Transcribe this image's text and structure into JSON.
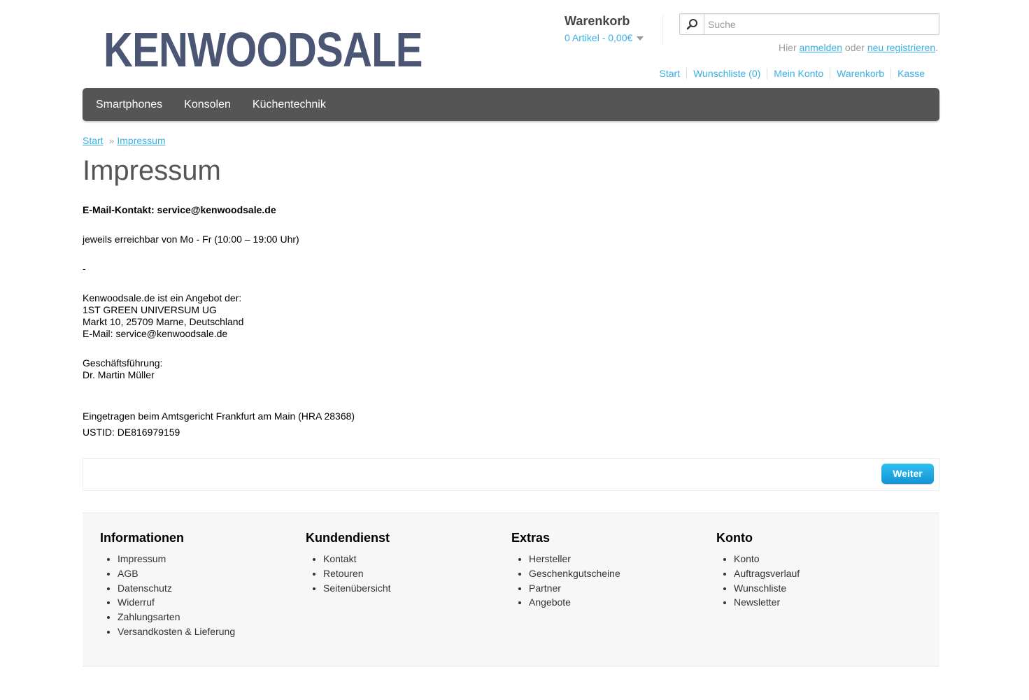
{
  "logo": "KENWOODSALE",
  "cart": {
    "title": "Warenkorb",
    "info": "0 Artikel - 0,00€"
  },
  "search": {
    "placeholder": "Suche"
  },
  "login": {
    "prefix": "Hier",
    "login_link": "anmelden",
    "middle": "oder",
    "register_link": "neu registrieren",
    "suffix": "."
  },
  "toplinks": [
    "Start",
    "Wunschliste (0)",
    "Mein Konto",
    "Warenkorb",
    "Kasse"
  ],
  "menu": [
    "Smartphones",
    "Konsolen",
    "Küchentechnik"
  ],
  "breadcrumb": {
    "home": "Start",
    "sep": "»",
    "current": "Impressum"
  },
  "page_title": "Impressum",
  "content": {
    "email_contact": "E-Mail-Kontakt: service@kenwoodsale.de",
    "hours": "jeweils erreichbar von Mo - Fr (10:00 – 19:00 Uhr)",
    "dash": "-",
    "company_line1": "Kenwoodsale.de ist ein Angebot der:",
    "company_line2": "1ST GREEN UNIVERSUM UG",
    "company_line3": "Markt 10, 25709 Marne, Deutschland",
    "company_line4": "E-Mail: service@kenwoodsale.de",
    "management_label": "Geschäftsführung:",
    "management_name": "Dr. Martin Müller",
    "register": "Eingetragen beim Amtsgericht Frankfurt am Main (HRA 28368)",
    "ustid": "USTID: DE816979159"
  },
  "weiter_button": "Weiter",
  "footer": [
    {
      "title": "Informationen",
      "items": [
        "Impressum",
        "AGB",
        "Datenschutz",
        "Widerruf",
        "Zahlungsarten",
        "Versandkosten & Lieferung"
      ]
    },
    {
      "title": "Kundendienst",
      "items": [
        "Kontakt",
        "Retouren",
        "Seitenübersicht"
      ]
    },
    {
      "title": "Extras",
      "items": [
        "Hersteller",
        "Geschenkgutscheine",
        "Partner",
        "Angebote"
      ]
    },
    {
      "title": "Konto",
      "items": [
        "Konto",
        "Auftragsverlauf",
        "Wunschliste",
        "Newsletter"
      ]
    }
  ]
}
